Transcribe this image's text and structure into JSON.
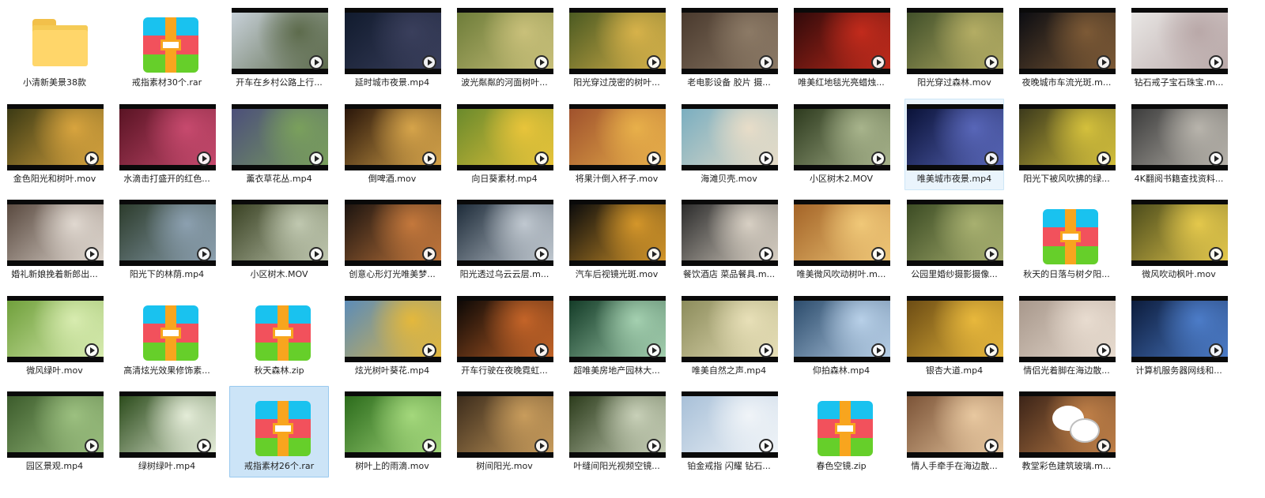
{
  "items": [
    {
      "name": "小清新美景38款",
      "type": "folder"
    },
    {
      "name": "戒指素材30个.rar",
      "type": "archive"
    },
    {
      "name": "开车在乡村公路上行...",
      "type": "video",
      "colors": [
        "#c7d0d8",
        "#5d6b4c"
      ]
    },
    {
      "name": "延时城市夜景.mp4",
      "type": "video",
      "colors": [
        "#111b2e",
        "#3a3f5c"
      ]
    },
    {
      "name": "波光粼粼的河面树叶...",
      "type": "video",
      "colors": [
        "#6e7d3a",
        "#c9c07a"
      ]
    },
    {
      "name": "阳光穿过茂密的树叶...",
      "type": "video",
      "colors": [
        "#4b5a22",
        "#d7b24a"
      ]
    },
    {
      "name": "老电影设备 胶片 摄...",
      "type": "video",
      "colors": [
        "#4a3a2e",
        "#8c7a66"
      ]
    },
    {
      "name": "唯美红地毯光亮蜡烛...",
      "type": "video",
      "colors": [
        "#300a0a",
        "#c22b1c"
      ]
    },
    {
      "name": "阳光穿过森林.mov",
      "type": "video",
      "colors": [
        "#41502a",
        "#b4ad64"
      ]
    },
    {
      "name": "夜晚城市车流光斑.m...",
      "type": "video",
      "colors": [
        "#0c0d12",
        "#7d5a36"
      ]
    },
    {
      "name": "钻石戒子宝石珠宝.m...",
      "type": "video",
      "colors": [
        "#e8e6e4",
        "#b9a8a8"
      ]
    },
    {
      "name": "金色阳光和树叶.mov",
      "type": "video",
      "colors": [
        "#3b3a14",
        "#d8a43e"
      ]
    },
    {
      "name": "水滴击打盛开的红色...",
      "type": "video",
      "colors": [
        "#5a1424",
        "#c74a6e"
      ]
    },
    {
      "name": "薰衣草花丛.mp4",
      "type": "video",
      "colors": [
        "#4c4f7a",
        "#7aa05c"
      ]
    },
    {
      "name": "倒啤酒.mov",
      "type": "video",
      "colors": [
        "#2a160a",
        "#d6a44a"
      ]
    },
    {
      "name": "向日葵素材.mp4",
      "type": "video",
      "colors": [
        "#6a8a2c",
        "#e8c43a"
      ]
    },
    {
      "name": "将果汁倒入杯子.mov",
      "type": "video",
      "colors": [
        "#a0522d",
        "#e8b04a"
      ]
    },
    {
      "name": "海滩贝壳.mov",
      "type": "video",
      "colors": [
        "#7aaec0",
        "#e8ddc8"
      ]
    },
    {
      "name": "小区树木2.MOV",
      "type": "video",
      "colors": [
        "#2d3a1e",
        "#a8b48c"
      ]
    },
    {
      "name": "唯美城市夜景.mp4",
      "type": "video",
      "colors": [
        "#0a1238",
        "#5866b8"
      ]
    },
    {
      "name": "阳光下被风吹拂的绿...",
      "type": "video",
      "colors": [
        "#3c3a1c",
        "#d4c03c"
      ]
    },
    {
      "name": "4K翻阅书籍查找资料...",
      "type": "video",
      "colors": [
        "#3c3c3c",
        "#b8b4ac"
      ]
    },
    {
      "name": "婚礼新娘挽着新郎出...",
      "type": "video",
      "colors": [
        "#5a4a40",
        "#e0d8d0"
      ]
    },
    {
      "name": "阳光下的林荫.mp4",
      "type": "video",
      "colors": [
        "#2c3c2c",
        "#8ca0b0"
      ]
    },
    {
      "name": "小区树木.MOV",
      "type": "video",
      "colors": [
        "#3a4224",
        "#c0c8b0"
      ]
    },
    {
      "name": "创意心形灯光唯美梦...",
      "type": "video",
      "colors": [
        "#1c1410",
        "#c4783c"
      ]
    },
    {
      "name": "阳光透过乌云云层.m...",
      "type": "video",
      "colors": [
        "#1e2c3a",
        "#c0c8d0"
      ]
    },
    {
      "name": "汽车后视镜光斑.mov",
      "type": "video",
      "colors": [
        "#0c0c0c",
        "#d4962a"
      ]
    },
    {
      "name": "餐饮酒店 菜品餐具.m...",
      "type": "video",
      "colors": [
        "#2c2c2c",
        "#d8d0c4"
      ]
    },
    {
      "name": "唯美微风吹动树叶.m...",
      "type": "video",
      "colors": [
        "#a46428",
        "#f0c878"
      ]
    },
    {
      "name": "公园里婚纱摄影摄像...",
      "type": "video",
      "colors": [
        "#3c4c24",
        "#a8b070"
      ]
    },
    {
      "name": "秋天的日落与树夕阳...",
      "type": "archive"
    },
    {
      "name": "微风吹动枫叶.mov",
      "type": "video",
      "colors": [
        "#4c4c1c",
        "#e4c84c"
      ]
    },
    {
      "name": "微风绿叶.mov",
      "type": "video",
      "colors": [
        "#70a03c",
        "#d8ecb0"
      ]
    },
    {
      "name": "高清炫光效果修饰素...",
      "type": "archive"
    },
    {
      "name": "秋天森林.zip",
      "type": "archive"
    },
    {
      "name": "炫光树叶葵花.mp4",
      "type": "video",
      "colors": [
        "#5c8cb8",
        "#e4b83c"
      ]
    },
    {
      "name": "开车行驶在夜晚霓虹...",
      "type": "video",
      "colors": [
        "#0c0806",
        "#c46428"
      ]
    },
    {
      "name": "超唯美房地产园林大...",
      "type": "video",
      "colors": [
        "#143c28",
        "#a4d0b0"
      ]
    },
    {
      "name": "唯美自然之声.mp4",
      "type": "video",
      "colors": [
        "#8c8c5c",
        "#e8e0b8"
      ]
    },
    {
      "name": "仰拍森林.mp4",
      "type": "video",
      "colors": [
        "#2c4c6c",
        "#b8d0e8"
      ]
    },
    {
      "name": "银杏大道.mp4",
      "type": "video",
      "colors": [
        "#6c4c14",
        "#e8b83c"
      ]
    },
    {
      "name": "情侣光着脚在海边散...",
      "type": "video",
      "colors": [
        "#a8988c",
        "#e8dcd0"
      ]
    },
    {
      "name": "计算机服务器网线和...",
      "type": "video",
      "colors": [
        "#0c1c3c",
        "#4c7cc8"
      ]
    },
    {
      "name": "园区景观.mp4",
      "type": "video",
      "colors": [
        "#3c5c2c",
        "#9cc080"
      ]
    },
    {
      "name": "绿树绿叶.mp4",
      "type": "video",
      "colors": [
        "#2c4c1c",
        "#e4ecd8"
      ]
    },
    {
      "name": "戒指素材26个.rar",
      "type": "archive",
      "selected": true
    },
    {
      "name": "树叶上的雨滴.mov",
      "type": "video",
      "colors": [
        "#2c6c1c",
        "#a4d87c"
      ]
    },
    {
      "name": "树间阳光.mov",
      "type": "video",
      "colors": [
        "#3c2c1c",
        "#c89c5c"
      ]
    },
    {
      "name": "叶缝间阳光视频空镜...",
      "type": "video",
      "colors": [
        "#2c3c1c",
        "#c8d0b8"
      ]
    },
    {
      "name": "铂金戒指 闪耀 钻石...",
      "type": "video",
      "colors": [
        "#a8c0d8",
        "#f0f4f8"
      ]
    },
    {
      "name": "春色空镜.zip",
      "type": "archive"
    },
    {
      "name": "情人手牵手在海边散...",
      "type": "video",
      "colors": [
        "#7c5438",
        "#e8c8a0"
      ]
    },
    {
      "name": "教堂彩色建筑玻璃.m...",
      "type": "video",
      "colors": [
        "#3c2418",
        "#c08048"
      ],
      "overlay": "wechat-logo"
    }
  ]
}
